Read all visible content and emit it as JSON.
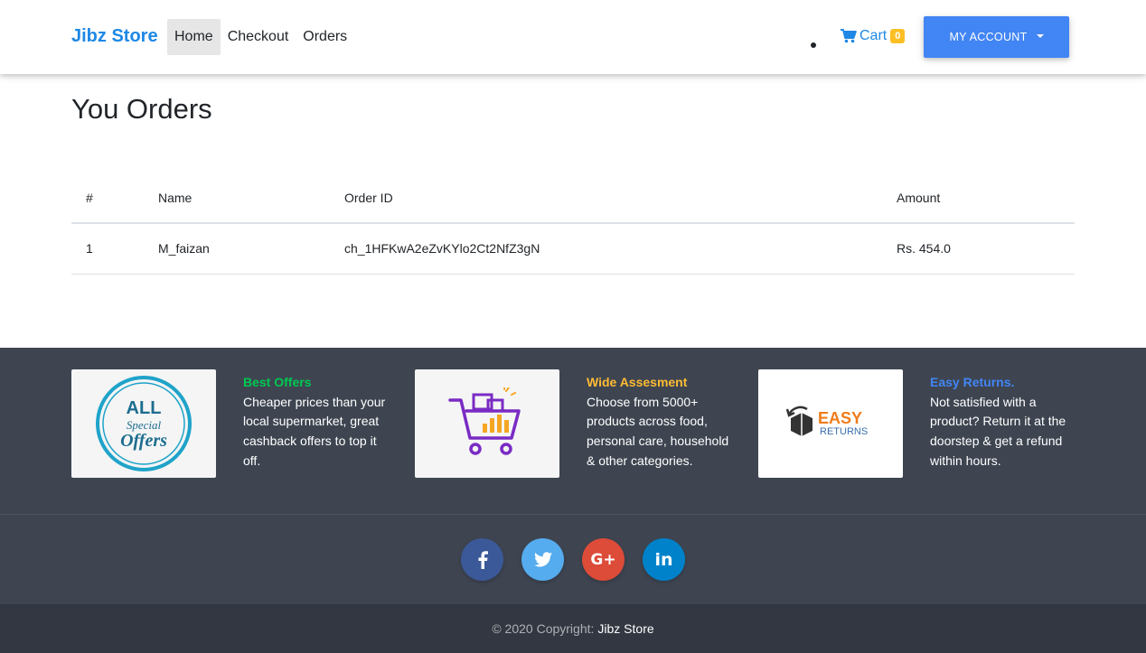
{
  "nav": {
    "brand": "Jibz Store",
    "links": [
      "Home",
      "Checkout",
      "Orders"
    ],
    "cart_label": "Cart",
    "cart_count": "0",
    "account_label": "MY ACCOUNT"
  },
  "main": {
    "title": "You Orders",
    "table": {
      "headers": [
        "#",
        "Name",
        "Order ID",
        "Amount"
      ],
      "rows": [
        [
          "1",
          "M_faizan",
          "ch_1HFKwA2eZvKYlo2Ct2NfZ3gN",
          "Rs. 454.0"
        ]
      ]
    }
  },
  "features": [
    {
      "title": "Best Offers",
      "text": "Cheaper prices than your local supermarket, great cashback offers to top it off.",
      "image_text": [
        "ALL",
        "Special",
        "Offers"
      ]
    },
    {
      "title": "Wide Assesment",
      "text": "Choose from 5000+ products across food, personal care, household & other categories."
    },
    {
      "title": "Easy Returns.",
      "text": "Not satisfied with a product? Return it at the doorstep & get a refund within hours.",
      "image_text": [
        "EASY",
        "RETURNS"
      ]
    }
  ],
  "social": {
    "gplus_label": "G+",
    "linkedin_label": "in"
  },
  "footer": {
    "copyright": "© 2020 Copyright:",
    "link": "Jibz Store"
  },
  "colors": {
    "brand": "#1e88e5",
    "account_button": "#4285f4",
    "badge": "#fbbf24",
    "footer_bg": "#3e4551",
    "copyright_bg": "#323741",
    "best_offers": "#00c851",
    "wide_assesment": "#ffbb33",
    "easy_returns": "#4285f4",
    "facebook": "#3b5998",
    "twitter": "#55acee",
    "google_plus": "#dd4b39",
    "linkedin": "#0082ca"
  },
  "icons": [
    "shopping-cart-icon",
    "caret-down-icon",
    "facebook-icon",
    "twitter-icon",
    "google-plus-icon",
    "linkedin-icon",
    "special-offers-badge",
    "shopping-cart-illustration",
    "return-box-icon"
  ]
}
